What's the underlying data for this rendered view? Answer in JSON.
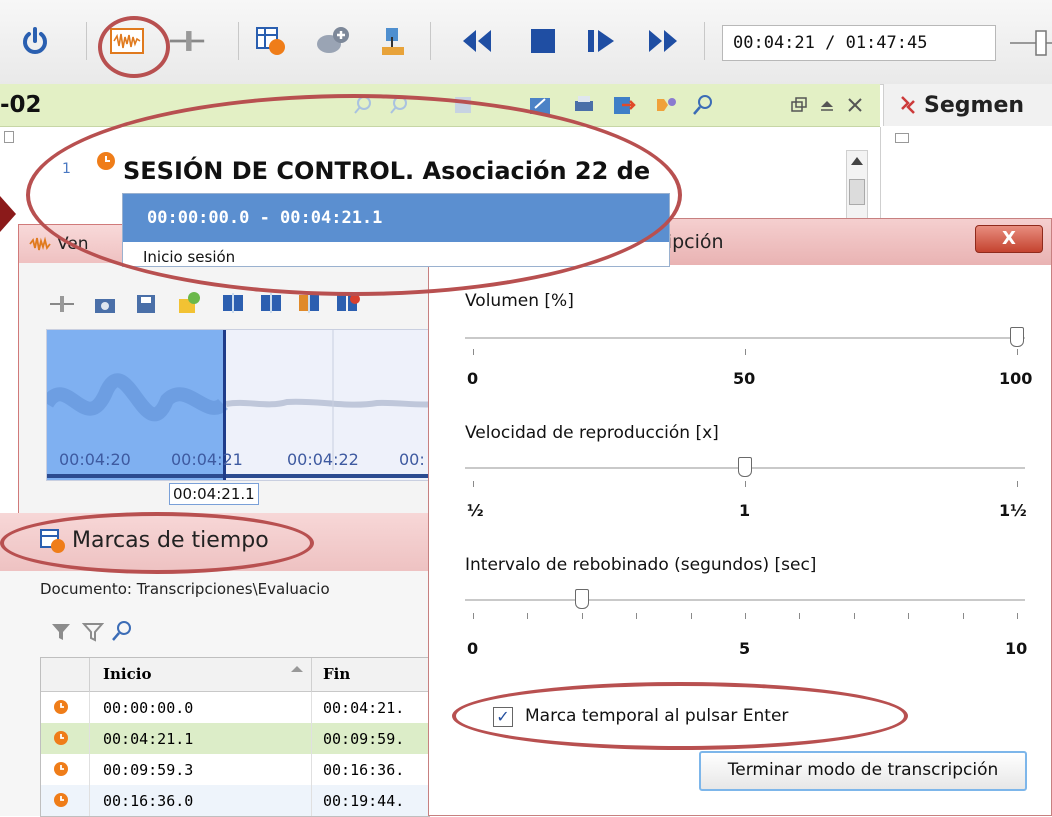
{
  "toolbar": {
    "time": "00:04:21 / 01:47:45",
    "icons": [
      "power-icon",
      "waveform-icon",
      "zoom-slider-icon",
      "timestamp-table-icon",
      "add-media-icon",
      "import-media-icon",
      "rewind-icon",
      "stop-icon",
      "step-forward-icon",
      "fast-forward-icon"
    ]
  },
  "document": {
    "title": "-02",
    "line_number": "1",
    "line_text": "SESIÓN DE CONTROL. Asociación 22 de"
  },
  "segments": {
    "title": "Segmen"
  },
  "tooltip": {
    "range": "00:00:00.0 - 00:04:21.1",
    "text": "Inicio sesión"
  },
  "wave_window": {
    "title": "Ven",
    "ticks": [
      "00:04:20",
      "00:04:21",
      "00:04:22",
      "00:"
    ],
    "cursor": "00:04:21.1"
  },
  "marks": {
    "title": "Marcas de tiempo",
    "path": "Documento: Transcripciones\\Evaluacio",
    "columns": {
      "start": "Inicio",
      "end": "Fin"
    },
    "rows": [
      {
        "start": "00:00:00.0",
        "end": "00:04:21.",
        "selected": false
      },
      {
        "start": "00:04:21.1",
        "end": "00:09:59.",
        "selected": true
      },
      {
        "start": "00:09:59.3",
        "end": "00:16:36.",
        "selected": false
      },
      {
        "start": "00:16:36.0",
        "end": "00:19:44.",
        "selected": false
      }
    ]
  },
  "dialog": {
    "title": "ripción",
    "close": "X",
    "volume": {
      "label": "Volumen [%]",
      "min": "0",
      "mid": "50",
      "max": "100",
      "value": 100
    },
    "speed": {
      "label": "Velocidad de reproducción [x]",
      "min": "½",
      "mid": "1",
      "max": "1½",
      "value": 1
    },
    "rewind": {
      "label": "Intervalo de rebobinado (segundos) [sec]",
      "min": "0",
      "mid": "5",
      "max": "10",
      "value": 2
    },
    "checkbox": {
      "label": "Marca temporal al pulsar Enter",
      "checked": true
    },
    "finish_button": "Terminar modo de transcripción"
  },
  "colors": {
    "highlight": "#b85050",
    "selection": "#5b8fd0",
    "docbar": "#e3f0c5"
  }
}
